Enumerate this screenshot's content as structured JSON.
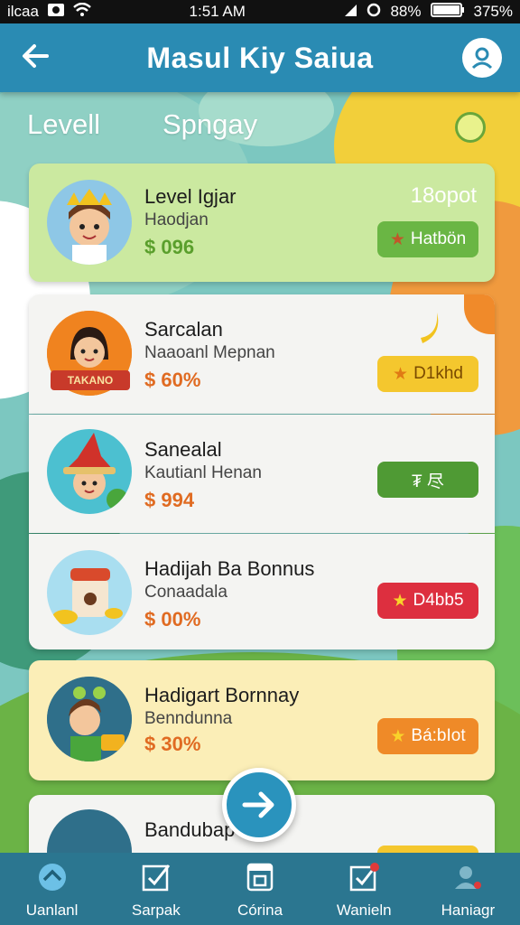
{
  "status_bar": {
    "carrier": "ilcaa",
    "time": "1:51 AM",
    "battery": "375%",
    "pct": "88%"
  },
  "header": {
    "title": "Masul Kiy Saiua"
  },
  "tabs": [
    {
      "label": "Levell"
    },
    {
      "label": "Spngay"
    }
  ],
  "cards": [
    {
      "title": "Level Igjar",
      "subtitle": "Haodjan",
      "price": "$ 096",
      "top_right": "18opot",
      "button": "Hatbön",
      "button_color": "#6ab644",
      "price_color": "#5a9f2c"
    },
    {
      "title": "Sarcalan",
      "subtitle": "Naaoanl Mepnan",
      "price": "$ 60%",
      "badge_text": "TAKANO",
      "button": "D1khd",
      "button_color": "#f4c72e",
      "price_color": "#e06b22"
    },
    {
      "title": "Sanealal",
      "subtitle": "Kautianl Henan",
      "price": "$ 994",
      "button": "₮ 尽",
      "button_color": "#4f9a34",
      "price_color": "#e06b22"
    },
    {
      "title": "Hadijah Ba Bonnus",
      "subtitle": "Conaadala",
      "price": "$ 00%",
      "button": "D4bb5",
      "button_color": "#dd2f3f",
      "price_color": "#e06b22"
    },
    {
      "title": "Hadigart Bornnay",
      "subtitle": "Benndunna",
      "price": "$ 30%",
      "button": "Bá:bIot",
      "button_color": "#ef8a28",
      "price_color": "#e06b22"
    },
    {
      "title": "Bandubap",
      "subtitle": ""
    }
  ],
  "bottom_nav": [
    {
      "label": "Uanlanl",
      "icon": "home-icon"
    },
    {
      "label": "Sarpak",
      "icon": "checklist-icon"
    },
    {
      "label": "Córina",
      "icon": "calendar-icon"
    },
    {
      "label": "Wanieln",
      "icon": "notification-check-icon"
    },
    {
      "label": "Haniagr",
      "icon": "profile-icon"
    }
  ],
  "colors": {
    "header": "#2a8bb3",
    "nav": "#2b7690",
    "fab": "#2a93bd"
  }
}
